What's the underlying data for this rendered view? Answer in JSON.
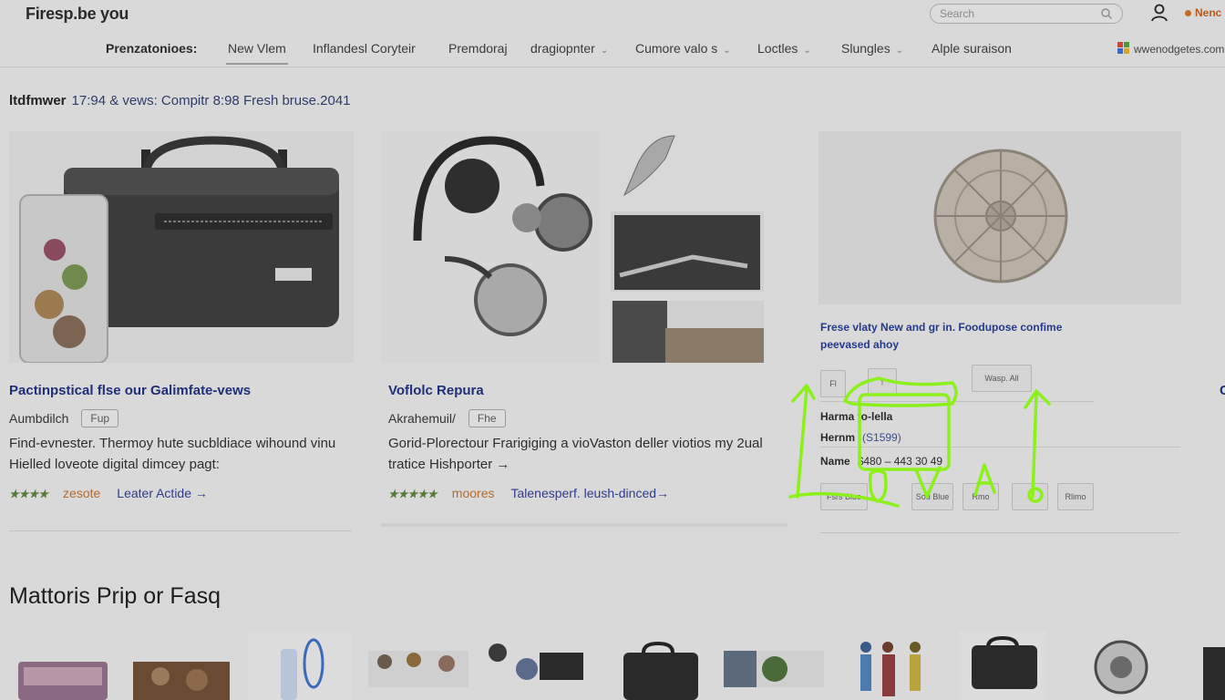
{
  "header": {
    "logo": "Firesp.be you",
    "search_placeholder": "Search",
    "account_label": "Nenc"
  },
  "nav": {
    "title": "Prenzatonioes:",
    "items": [
      {
        "label": "New Vlem",
        "active": true,
        "dropdown": false
      },
      {
        "label": "Inflandesl Coryteir",
        "active": false,
        "dropdown": false
      },
      {
        "label": "Premdoraj",
        "active": false,
        "dropdown": false
      },
      {
        "label": "dragiopnter",
        "active": false,
        "dropdown": true
      },
      {
        "label": "Cumore valo s",
        "active": false,
        "dropdown": true
      },
      {
        "label": "Loctles",
        "active": false,
        "dropdown": true
      },
      {
        "label": "Slungles",
        "active": false,
        "dropdown": true
      },
      {
        "label": "Alple suraison",
        "active": false,
        "dropdown": false
      }
    ],
    "partner_label": "wwenodgetes.com"
  },
  "breadcrumb": {
    "bold": "ltdfmwer",
    "text": "17:94 & vews: Compitr 8:98 Fresh bruse.2041"
  },
  "cards": [
    {
      "title": "Pactinpstical flse our Galimfate-vews",
      "meta": "Aumbdilch",
      "chip": "Fup",
      "desc": "Find-evnester. Thermoy hute sucbldiace wihound vinu Hielled loveote digital dimcey pagt:",
      "badge": "zesote",
      "tag": "zesote",
      "link": "Leater Actide →"
    },
    {
      "title": "Voflolc Repura",
      "meta": "Akrahemuil/",
      "chip": "Fhe",
      "desc": "Gorid-Plorectour Frarigiging a vioVaston deller viotios my 2ual tratice Hishporter →",
      "badge": "moores",
      "tag": "moores",
      "link": "Talenesperf. leush-dinced→"
    }
  ],
  "card3": {
    "promo": "Frese vlaty New and gr in. Foodupose confime peevased ahoy",
    "rows": [
      {
        "label": "Harma to-lella",
        "value": ""
      },
      {
        "label": "Hernm",
        "value": "(S1599)"
      },
      {
        "label": "Name",
        "value": "$480 – 443 30 49"
      }
    ],
    "top_buttons": [
      "Fl",
      "Wasp. All"
    ],
    "bottom_buttons": [
      "Fsrs Blue",
      "Sod Blue",
      "",
      "Rmo",
      "Rlimo"
    ]
  },
  "section": {
    "title": "Mattoris Prip or Fasq"
  },
  "colors": {
    "title_blue": "#1f2f78",
    "tag_orange": "#b56a2c",
    "annotation_green": "#8cf01a",
    "background": "#d9d9d9"
  }
}
